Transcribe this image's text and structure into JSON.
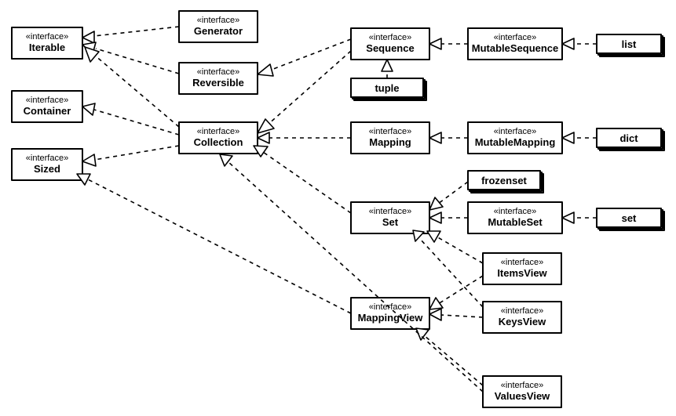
{
  "nodes": {
    "Iterable": {
      "stereo": "«interface»",
      "name": "Iterable"
    },
    "Container": {
      "stereo": "«interface»",
      "name": "Container"
    },
    "Sized": {
      "stereo": "«interface»",
      "name": "Sized"
    },
    "Generator": {
      "stereo": "«interface»",
      "name": "Generator"
    },
    "Reversible": {
      "stereo": "«interface»",
      "name": "Reversible"
    },
    "Collection": {
      "stereo": "«interface»",
      "name": "Collection"
    },
    "Sequence": {
      "stereo": "«interface»",
      "name": "Sequence"
    },
    "MutableSequence": {
      "stereo": "«interface»",
      "name": "MutableSequence"
    },
    "list": {
      "name": "list"
    },
    "tuple": {
      "name": "tuple"
    },
    "Mapping": {
      "stereo": "«interface»",
      "name": "Mapping"
    },
    "MutableMapping": {
      "stereo": "«interface»",
      "name": "MutableMapping"
    },
    "dict": {
      "name": "dict"
    },
    "frozenset": {
      "name": "frozenset"
    },
    "Set": {
      "stereo": "«interface»",
      "name": "Set"
    },
    "MutableSet": {
      "stereo": "«interface»",
      "name": "MutableSet"
    },
    "set": {
      "name": "set"
    },
    "ItemsView": {
      "stereo": "«interface»",
      "name": "ItemsView"
    },
    "MappingView": {
      "stereo": "«interface»",
      "name": "MappingView"
    },
    "KeysView": {
      "stereo": "«interface»",
      "name": "KeysView"
    },
    "ValuesView": {
      "stereo": "«interface»",
      "name": "ValuesView"
    }
  },
  "edges": [
    [
      "Generator",
      "Iterable"
    ],
    [
      "Reversible",
      "Iterable"
    ],
    [
      "Collection",
      "Iterable"
    ],
    [
      "Collection",
      "Container"
    ],
    [
      "Collection",
      "Sized"
    ],
    [
      "Sequence",
      "Reversible"
    ],
    [
      "Sequence",
      "Collection"
    ],
    [
      "MutableSequence",
      "Sequence"
    ],
    [
      "list",
      "MutableSequence"
    ],
    [
      "tuple",
      "Sequence"
    ],
    [
      "Mapping",
      "Collection"
    ],
    [
      "MutableMapping",
      "Mapping"
    ],
    [
      "dict",
      "MutableMapping"
    ],
    [
      "Set",
      "Collection"
    ],
    [
      "frozenset",
      "Set"
    ],
    [
      "MutableSet",
      "Set"
    ],
    [
      "set",
      "MutableSet"
    ],
    [
      "ItemsView",
      "Set"
    ],
    [
      "ItemsView",
      "MappingView"
    ],
    [
      "KeysView",
      "Set"
    ],
    [
      "KeysView",
      "MappingView"
    ],
    [
      "ValuesView",
      "MappingView"
    ],
    [
      "ValuesView",
      "Collection"
    ],
    [
      "MappingView",
      "Sized"
    ]
  ]
}
